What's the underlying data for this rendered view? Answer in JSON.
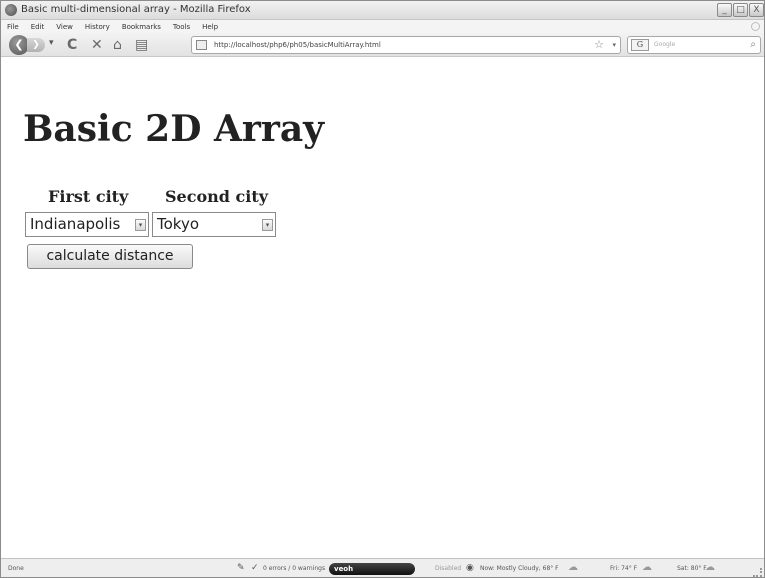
{
  "window": {
    "title": "Basic multi-dimensional array - Mozilla Firefox",
    "controls": {
      "minimize": "_",
      "maximize": "□",
      "close": "X"
    }
  },
  "menu": {
    "items": [
      "File",
      "Edit",
      "View",
      "History",
      "Bookmarks",
      "Tools",
      "Help"
    ]
  },
  "toolbar": {
    "back_glyph": "❮",
    "forward_glyph": "❯",
    "dropdown_glyph": "▾",
    "reload_glyph": "C",
    "stop_glyph": "✕",
    "home_glyph": "⌂",
    "bookmark_glyph": "▤",
    "url": "http://localhost/php6/ph05/basicMultiArray.html",
    "star_glyph": "☆",
    "url_drop_glyph": "▾",
    "search_engine": "G",
    "search_placeholder": "Google",
    "search_glyph": "⌕"
  },
  "page": {
    "heading": "Basic 2D Array",
    "first_label": "First city",
    "second_label": "Second city",
    "first_city": "Indianapolis",
    "second_city": "Tokyo",
    "select_arrow": "▾",
    "calculate_button": "calculate distance"
  },
  "statusbar": {
    "status": "Done",
    "errors": "0 errors / 0 warnings",
    "veoh": "veoh",
    "disabled": "Disabled",
    "weather_now": "Now: Mostly Cloudy, 68° F",
    "forecast_fri": "Fri: 74° F",
    "forecast_sat": "Sat: 80° F",
    "plug_glyph": "✎",
    "check_glyph": "✓",
    "globe_glyph": "◉",
    "cloud_glyph": "☁"
  }
}
